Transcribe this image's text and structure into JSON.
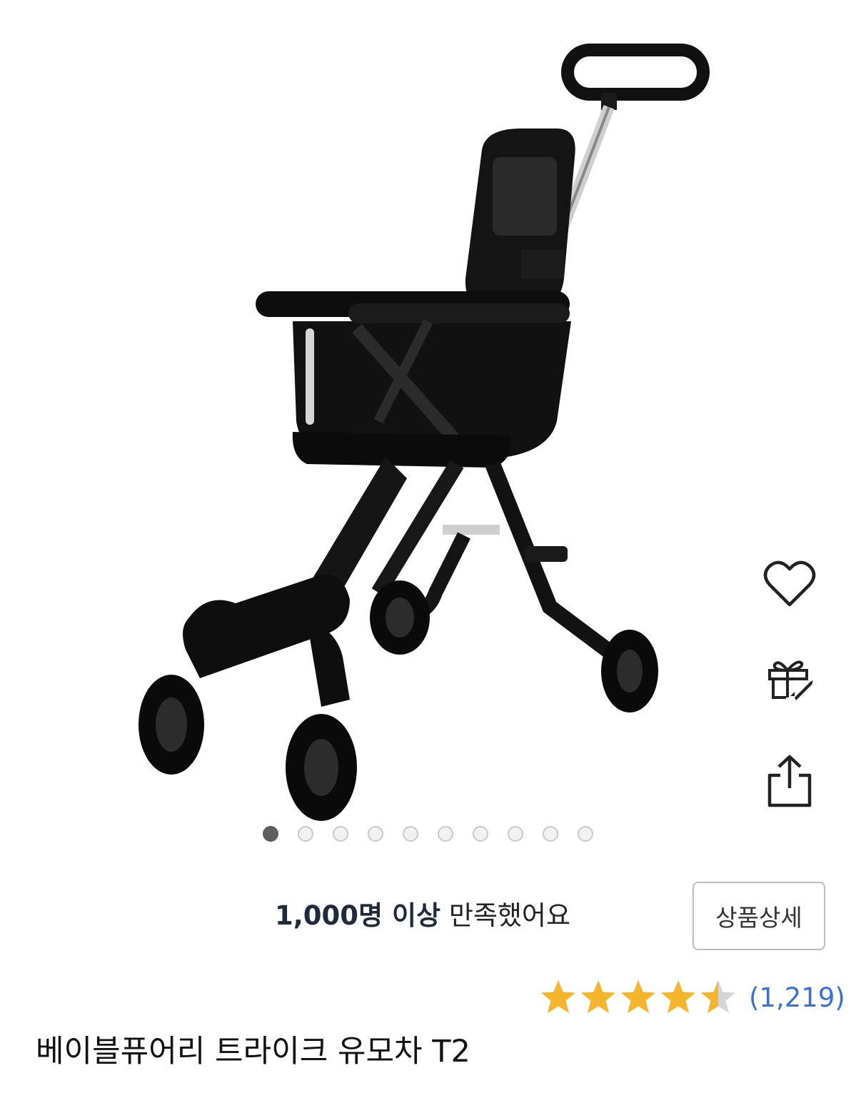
{
  "product": {
    "title": "베이블퓨어리 트라이크 유모차 T2",
    "image": "black-tricycle-stroller-photo",
    "image_count": 10,
    "active_image": 1
  },
  "actions": [
    {
      "name": "wishlist",
      "icon": "heart-icon"
    },
    {
      "name": "gift",
      "icon": "gift-rocket-icon"
    },
    {
      "name": "share",
      "icon": "share-icon"
    }
  ],
  "satisfaction": {
    "highlight": "1,000명 이상",
    "rest": "만족했어요"
  },
  "detail_button": {
    "label": "상품상세"
  },
  "rating": {
    "stars": 4.5,
    "max": 5,
    "review_count": "(1,219)"
  },
  "colors": {
    "star_filled": "#f5b62e",
    "star_empty": "#d5d5d5",
    "review_link": "#3a6fd8",
    "dot_active": "#5e5e5e",
    "dot_inactive": "#f2f2f2"
  }
}
